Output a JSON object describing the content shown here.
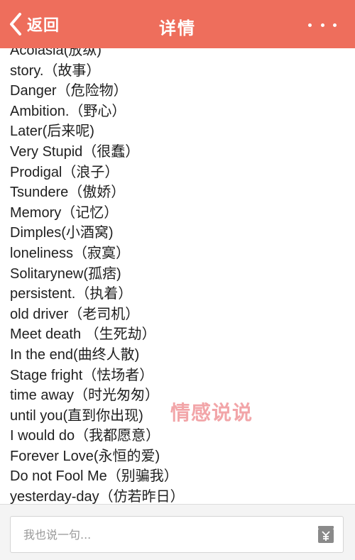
{
  "header": {
    "back_label": "返回",
    "title": "详情",
    "more_icon": "more-dots-icon"
  },
  "entries": [
    "Acolasia(放纵)",
    "story.（故事）",
    "Danger（危险物）",
    "Ambition.（野心）",
    "Later(后来呢)",
    "Very Stupid（很蠢）",
    "Prodigal（浪子）",
    "Tsundere（傲娇）",
    "Memory（记忆）",
    "Dimples(小酒窝)",
    "loneliness（寂寞）",
    "Solitarynew(孤痞)",
    "persistent.（执着）",
    "old driver（老司机）",
    "Meet death （生死劫）",
    "In the end(曲终人散)",
    "Stage fright（怯场者）",
    "time away（时光匆匆）",
    "until you(直到你出现)",
    "I would do（我都愿意）",
    "Forever Love(永恒的爱)",
    "Do not Fool Me（别骗我）",
    "yesterday-day（仿若昨日）"
  ],
  "watermark": "情感说说",
  "comment": {
    "placeholder": "我也说一句..."
  },
  "colors": {
    "header_bg": "#ee6e5c",
    "watermark": "#f2a5a8"
  }
}
